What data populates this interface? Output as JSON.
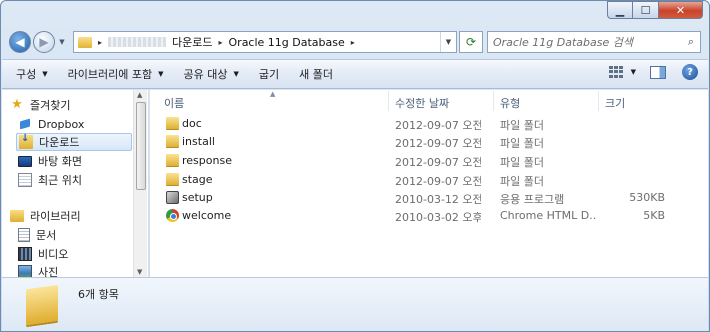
{
  "window": {
    "minimize_glyph": "▁",
    "maximize_glyph": "☐",
    "close_glyph": "✕"
  },
  "address": {
    "segments": [
      "다운로드",
      "Oracle 11g Database"
    ],
    "separator": "▸"
  },
  "search": {
    "placeholder": "Oracle 11g Database 검색"
  },
  "toolbar": {
    "organize": "구성",
    "include_in_library": "라이브러리에 포함",
    "share_with": "공유 대상",
    "burn": "굽기",
    "new_folder": "새 폴더"
  },
  "nav": {
    "favorites": "즐겨찾기",
    "dropbox": "Dropbox",
    "downloads": "다운로드",
    "desktop": "바탕 화면",
    "recent": "최근 위치",
    "libraries": "라이브러리",
    "documents": "문서",
    "videos": "비디오",
    "pictures": "사진"
  },
  "columns": {
    "name": "이름",
    "date_modified": "수정한 날짜",
    "type": "유형",
    "size": "크기"
  },
  "files": [
    {
      "name": "doc",
      "date": "2012-09-07 오전...",
      "type": "파일 폴더",
      "size": "",
      "icon": "folder"
    },
    {
      "name": "install",
      "date": "2012-09-07 오전...",
      "type": "파일 폴더",
      "size": "",
      "icon": "folder"
    },
    {
      "name": "response",
      "date": "2012-09-07 오전...",
      "type": "파일 폴더",
      "size": "",
      "icon": "folder"
    },
    {
      "name": "stage",
      "date": "2012-09-07 오전...",
      "type": "파일 폴더",
      "size": "",
      "icon": "folder"
    },
    {
      "name": "setup",
      "date": "2010-03-12 오전...",
      "type": "응용 프로그램",
      "size": "530KB",
      "icon": "setup"
    },
    {
      "name": "welcome",
      "date": "2010-03-02 오후...",
      "type": "Chrome HTML D...",
      "size": "5KB",
      "icon": "html"
    }
  ],
  "details": {
    "item_count": "6개 항목"
  },
  "colors": {
    "selection": "#d7e7f8",
    "toolbar": "#e3ebf6",
    "header_text": "#4c607a"
  }
}
